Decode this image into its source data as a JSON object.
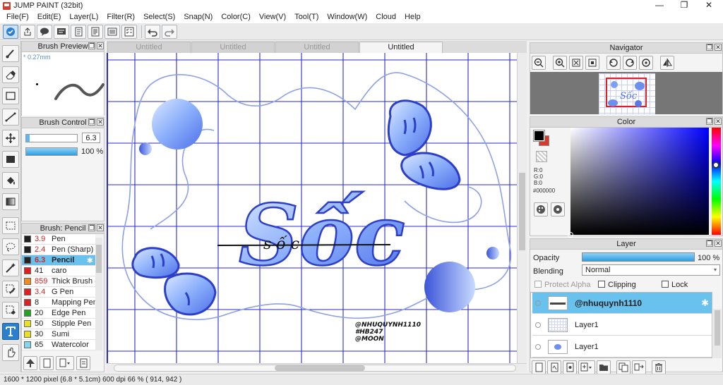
{
  "window": {
    "title": "JUMP PAINT (32bit)",
    "controls": [
      "—",
      "❐",
      "✕"
    ]
  },
  "menu": [
    "File(F)",
    "Edit(E)",
    "Layer(L)",
    "Filter(R)",
    "Select(S)",
    "Snap(N)",
    "Color(C)",
    "View(V)",
    "Tool(T)",
    "Window(W)",
    "Cloud",
    "Help"
  ],
  "brush_preview": {
    "title": "Brush Preview",
    "size_label": "* 0.27mm"
  },
  "brush_control": {
    "title": "Brush Control",
    "size_value": "6.3",
    "opacity_value": "100 %",
    "size_fraction": 0.07,
    "opacity_fraction": 1.0
  },
  "brush_list": {
    "title": "Brush: Pencil",
    "items": [
      {
        "size": "3.9",
        "name": "Pen",
        "color": "#1e1e1e"
      },
      {
        "size": "2.4",
        "name": "Pen (Sharp)",
        "color": "#1e1e1e"
      },
      {
        "size": "6.3",
        "name": "Pencil",
        "color": "#222222"
      },
      {
        "size": "41",
        "name": "caro",
        "color": "#e02020"
      },
      {
        "size": "859",
        "name": "Thick Brush (S",
        "color": "#f08c1c"
      },
      {
        "size": "3.4",
        "name": "G Pen",
        "color": "#e02020"
      },
      {
        "size": "8",
        "name": "Mapping Pen",
        "color": "#e02020"
      },
      {
        "size": "20",
        "name": "Edge Pen",
        "color": "#22a422"
      },
      {
        "size": "50",
        "name": "Stipple Pen",
        "color": "#e8e020"
      },
      {
        "size": "30",
        "name": "Sumi",
        "color": "#e8e020"
      },
      {
        "size": "65",
        "name": "Watercolor",
        "color": "#7fd8f0"
      }
    ]
  },
  "tabs": [
    "Untitled",
    "Untitled",
    "Untitled",
    "Untitled"
  ],
  "canvas": {
    "art_text": "Sốc",
    "inner_text": "s ố c",
    "watermark": [
      "@NHUQUYNH1110",
      "#HB247",
      "@MOON"
    ]
  },
  "navigator": {
    "title": "Navigator"
  },
  "color": {
    "title": "Color",
    "rgb": [
      "R:0",
      "G:0",
      "B:0"
    ],
    "hex": "#000000"
  },
  "layer": {
    "title": "Layer",
    "opacity_label": "Opacity",
    "opacity_value": "100 %",
    "blending_label": "Blending",
    "blending_value": "Normal",
    "protect_alpha": "Protect Alpha",
    "clipping": "Clipping",
    "lock": "Lock",
    "layers": [
      "@nhuquynh1110",
      "Layer1",
      "Layer1"
    ]
  },
  "status": {
    "text": "1600 * 1200 pixel   (6.8 * 5.1cm)   600 dpi   66 %   ( 914, 942 )"
  }
}
